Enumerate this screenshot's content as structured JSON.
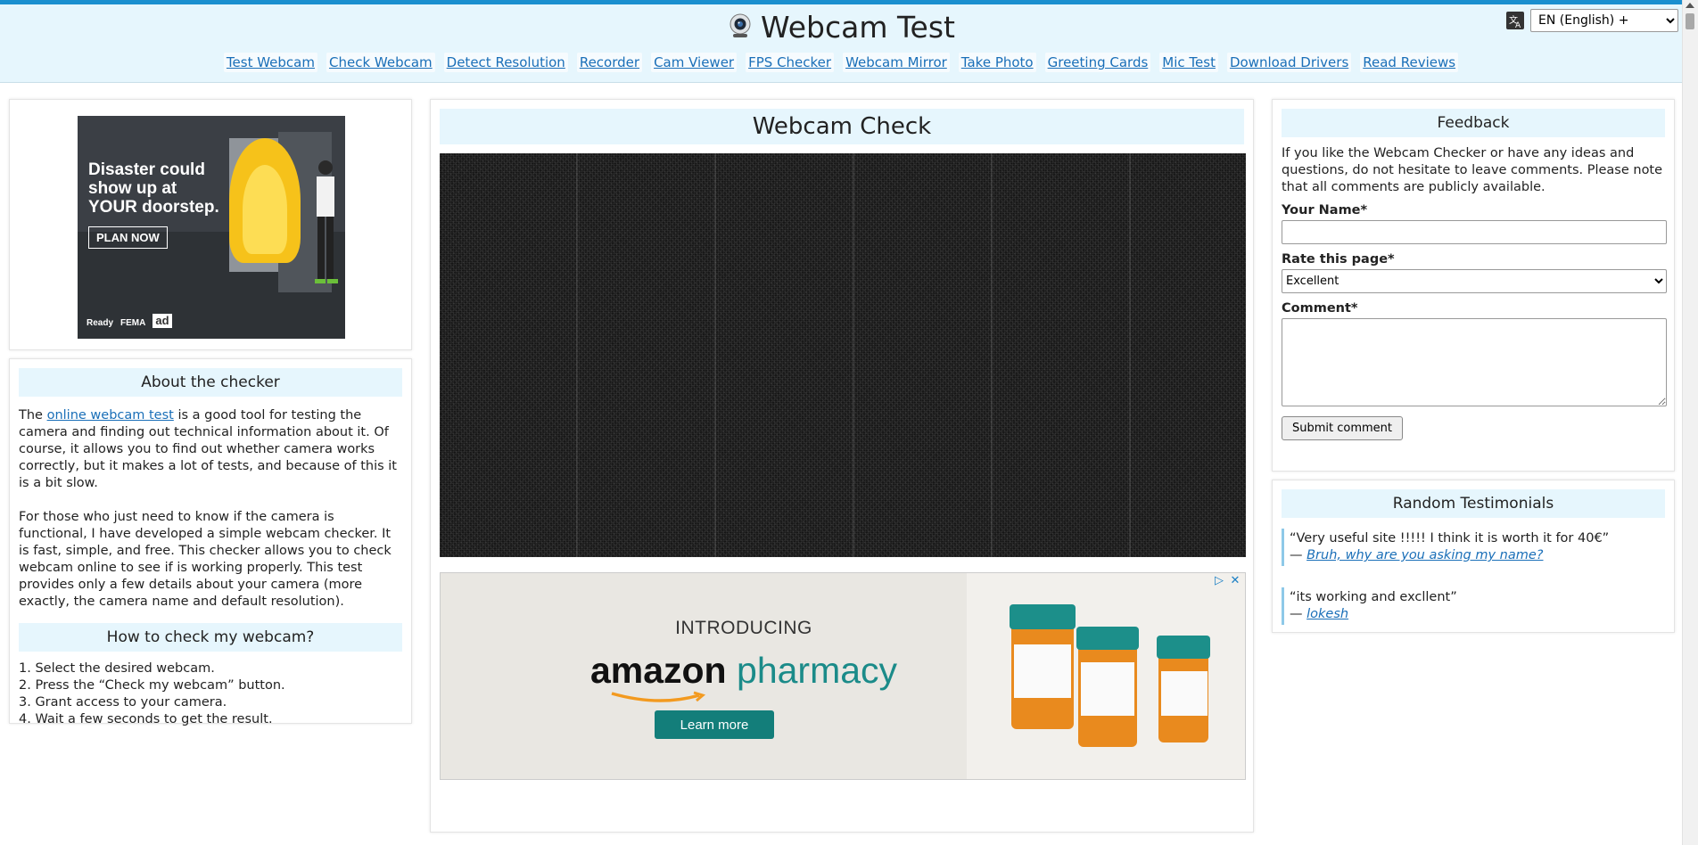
{
  "header": {
    "title": "Webcam Test",
    "language": {
      "selected": "EN (English) +"
    },
    "nav": [
      "Test Webcam",
      "Check Webcam",
      "Detect Resolution",
      "Recorder",
      "Cam Viewer",
      "FPS Checker",
      "Webcam Mirror",
      "Take Photo",
      "Greeting Cards",
      "Mic Test",
      "Download Drivers",
      "Read Reviews"
    ]
  },
  "left_ad": {
    "headline_1": "Disaster could",
    "headline_2": "show up at",
    "headline_3": "YOUR doorstep.",
    "button": "PLAN NOW",
    "logo_ready": "Ready",
    "logo_fema": "FEMA",
    "logo_ad": "ad"
  },
  "about": {
    "title": "About the checker",
    "p1_before": "The ",
    "p1_link": "online webcam test",
    "p1_after": " is a good tool for testing the camera and finding out technical information about it. Of course, it allows you to find out whether camera works correctly, but it makes a lot of tests, and because of this it is a bit slow.",
    "p2": "For those who just need to know if the camera is functional, I have developed a simple webcam checker. It is fast, simple, and free. This checker allows you to check webcam online to see if is working properly. This test provides only a few details about your camera (more exactly, the camera name and default resolution)."
  },
  "howto": {
    "title": "How to check my webcam?",
    "steps": [
      "1. Select the desired webcam.",
      "2. Press the “Check my webcam” button.",
      "3. Grant access to your camera.",
      "4. Wait a few seconds to get the result."
    ]
  },
  "main": {
    "title": "Webcam Check"
  },
  "amazon_ad": {
    "intro": "INTRODUCING",
    "brand_1": "amazon",
    "brand_2": "pharmacy",
    "button": "Learn more"
  },
  "feedback": {
    "title": "Feedback",
    "intro": "If you like the Webcam Checker or have any ideas and questions, do not hesitate to leave comments. Please note that all comments are publicly available.",
    "name_label": "Your Name*",
    "name_value": "",
    "rate_label": "Rate this page*",
    "rate_value": "Excellent",
    "comment_label": "Comment*",
    "comment_value": "",
    "submit": "Submit comment"
  },
  "testimonials": {
    "title": "Random Testimonials",
    "items": [
      {
        "quote": "“Very useful site !!!!! I think it is worth it for 40€”",
        "author": "Bruh, why are you asking my name?"
      },
      {
        "quote": "“its working and excllent”",
        "author": "lokesh"
      }
    ]
  },
  "colors": {
    "accent": "#1a8fcf",
    "header_bg": "#e6f6fd",
    "link": "#1a6fb8",
    "amazon_teal": "#137e7a"
  }
}
